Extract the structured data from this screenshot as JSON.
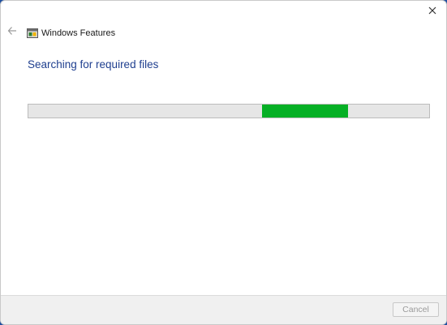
{
  "window": {
    "title": "Windows Features",
    "app_icon": "windows-features-icon",
    "close_icon": "close-icon",
    "back_icon": "back-arrow-icon"
  },
  "main": {
    "heading": "Searching for required files",
    "progress": {
      "state": "indeterminate",
      "fill_color": "#06b025",
      "track_color": "#e6e6e6"
    }
  },
  "footer": {
    "cancel_label": "Cancel",
    "cancel_enabled": false
  },
  "colors": {
    "heading": "#1f3f8f",
    "desktop_background": "#1f4fa0"
  }
}
